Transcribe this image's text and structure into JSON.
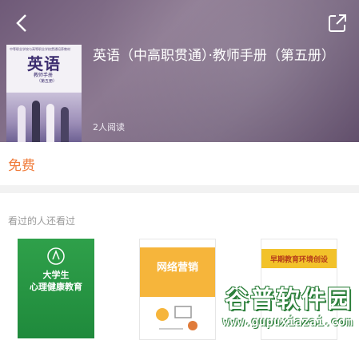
{
  "header": {
    "book_title": "英语（中高职贯通）·教师手册（第五册）",
    "readers": "2人阅读",
    "cover": {
      "series": "中等职业学校与高等职业学校贯通培养教材",
      "title": "英语",
      "subtitle": "教师手册",
      "edition": "（第五册）"
    }
  },
  "price": {
    "label": "免费",
    "color": "#f07b3a"
  },
  "recommend": {
    "title": "看过的人还看过",
    "books": [
      {
        "cover_title": "大学生\n心理健康教育",
        "color": "#2fa04a"
      },
      {
        "cover_title": "网络营销",
        "color": "#f6b53b"
      },
      {
        "cover_title": "早期教育环境创设",
        "color": "#f2c22a"
      }
    ]
  },
  "watermark": {
    "main": "谷普软件园",
    "url": "www.gupuxiazai.com"
  }
}
